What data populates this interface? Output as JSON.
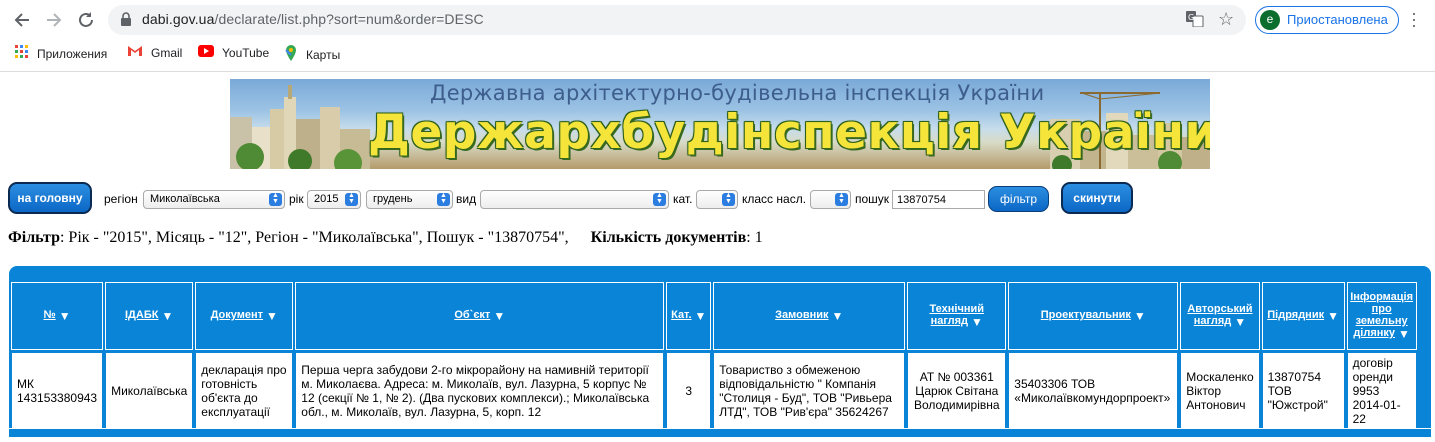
{
  "browser": {
    "url_host": "dabi.gov.ua",
    "url_path": "/declarate/list.php?sort=num&order=DESC",
    "profile_initial": "e",
    "profile_label": "Приостановлена",
    "bookmarks": [
      {
        "label": "Приложения",
        "icon": "apps-grid-icon"
      },
      {
        "label": "Gmail",
        "icon": "gmail-icon"
      },
      {
        "label": "YouTube",
        "icon": "youtube-icon"
      },
      {
        "label": "Карты",
        "icon": "maps-icon"
      }
    ]
  },
  "banner": {
    "subtitle": "Державна архітектурно-будівельна інспекція України",
    "title": "Держархбудінспекція України"
  },
  "filters": {
    "home_button": "на головну",
    "region_label": "регіон",
    "region_value": "Миколаївська",
    "year_label": "рік",
    "year_value": "2015",
    "month_value": "грудень",
    "type_label": "вид",
    "type_value": "",
    "cat_label": "кат.",
    "cat_value": "",
    "class_label": "класс насл.",
    "class_value": "",
    "search_label": "пошук",
    "search_value": "13870754",
    "filter_button": "фільтр",
    "reset_button": "скинути"
  },
  "summary": {
    "filter_label": "Фільтр",
    "filter_text": ": Рік - \"2015\", Місяць - \"12\", Регіон - \"Миколаївська\", Пошук - \"13870754\",",
    "count_label": "Кількість документів",
    "count_text": ": 1"
  },
  "table": {
    "headers": [
      "№",
      "ІДАБК",
      "Документ",
      "Об`єкт",
      "Кат.",
      "Замовник",
      "Технічний нагляд",
      "Проектувальник",
      "Авторський нагляд",
      "Підрядник",
      "Інформація про земельну ділянку"
    ],
    "rows": [
      [
        "МК 143153380943",
        "Миколаївська",
        "декларація про готовність об'єкта до експлуатації",
        "Перша черга забудови 2-го мікрорайону на намивній території м. Миколаєва. Адреса: м. Миколаїв, вул. Лазурна, 5 корпус № 12 (секції № 1, № 2). (Два пускових комплекси).; Миколаївська обл., м. Миколаїв, вул. Лазурна, 5, корп. 12",
        "3",
        "Товариство з обмеженою відповідальністю \" Компанія \"Столиця - Буд\", ТОВ \"Ривьера ЛТД\", ТОВ \"Рив'єра\" 35624267",
        "АТ № 003361 Царюк Світана Володимирівна",
        "35403306 ТОВ «Миколаївкомундорпроект»",
        "Москаленко Віктор Антонович",
        "13870754 ТОВ \"Южстрой\"",
        "договір оренди 9953 2014-01-22"
      ]
    ]
  },
  "colors": {
    "table_blue": "#0a84d6",
    "button_blue": "#1a7ad8",
    "banner_yellow": "#f5e53a"
  }
}
